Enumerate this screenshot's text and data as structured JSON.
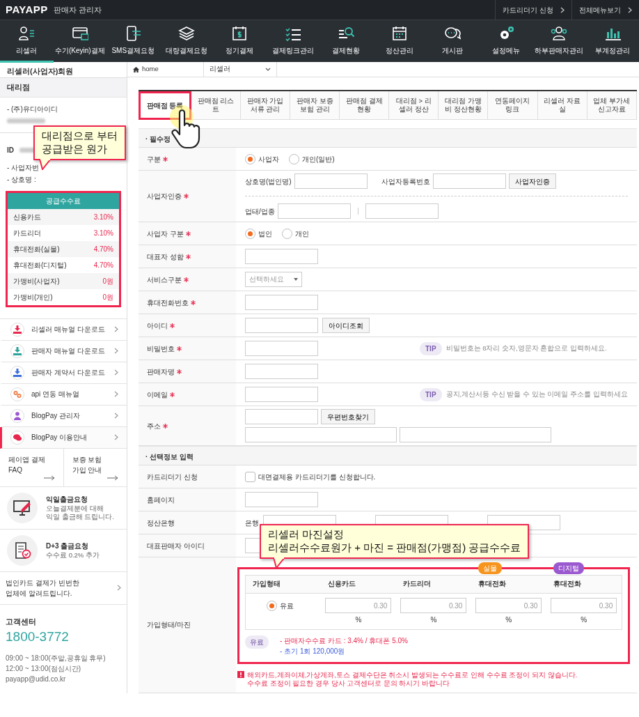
{
  "header": {
    "logo": "PAYAPP",
    "subtitle": "판매자 관리자",
    "links": [
      {
        "label": "카드리더기 신청"
      },
      {
        "label": "전체메뉴보기"
      }
    ]
  },
  "nav": [
    {
      "label": "리셀러",
      "selected": true
    },
    {
      "label": "수기(Keyin)결제",
      "selected": false
    },
    {
      "label": "SMS결제요청",
      "selected": false
    },
    {
      "label": "대량결제요청",
      "selected": false
    },
    {
      "label": "정기결제",
      "selected": false
    },
    {
      "label": "결제링크관리",
      "selected": false
    },
    {
      "label": "결제현황",
      "selected": false
    },
    {
      "label": "정산관리",
      "selected": false
    },
    {
      "label": "게시판",
      "selected": false
    },
    {
      "label": "설정메뉴",
      "selected": false
    },
    {
      "label": "하부판매자관리",
      "selected": false
    },
    {
      "label": "부계정관리",
      "selected": false
    }
  ],
  "sidebar": {
    "member_type": "리셀러(사업자)회원",
    "agency": {
      "title": "대리점",
      "lines": [
        "- (주)유디아이디"
      ]
    },
    "account": {
      "id_label": "ID",
      "lines": [
        "- 사업자번",
        "- 상호명 :"
      ]
    },
    "fee_table": {
      "title": "공급수수료",
      "rows": [
        {
          "name": "신용카드",
          "value": "3.10%"
        },
        {
          "name": "카드리더",
          "value": "3.10%"
        },
        {
          "name": "휴대전화(실물)",
          "value": "4.70%"
        },
        {
          "name": "휴대전화(디지털)",
          "value": "4.70%"
        },
        {
          "name": "가맹비(사업자)",
          "value": "0원"
        },
        {
          "name": "가맹비(개인)",
          "value": "0원"
        }
      ]
    },
    "menu": [
      {
        "label": "리셀러 매뉴얼 다운로드",
        "kind": "download",
        "color": "#e8264c",
        "selected": false
      },
      {
        "label": "판매자 매뉴얼 다운로드",
        "kind": "download",
        "color": "#2aa39a",
        "selected": false
      },
      {
        "label": "판매자 계약서 다운로드",
        "kind": "download",
        "color": "#3b6fd8",
        "selected": false
      },
      {
        "label": "api 연동 매뉴얼",
        "kind": "link",
        "color": "#f07b3f",
        "selected": false
      },
      {
        "label": "BlogPay 관리자",
        "kind": "person",
        "color": "#9b59d0",
        "selected": false
      },
      {
        "label": "BlogPay 이용안내",
        "kind": "chat",
        "color": "#e8264c",
        "selected": true
      }
    ],
    "quick_links": [
      {
        "text": "페이앱 결제\nFAQ"
      },
      {
        "text": "보증 보험\n가입 안내"
      }
    ],
    "promos": [
      {
        "kind": "monitor",
        "title": "익일출금요청",
        "desc": "오늘결제분에 대해\n익일 출금해 드립니다."
      },
      {
        "kind": "document",
        "title": "D+3 출금요청",
        "desc": "수수료 0.2% 추가"
      }
    ],
    "notice": "법인카드 결제가 빈번한\n업체에 알려드립니다.",
    "support": {
      "title": "고객센터",
      "phone": "1800-3772",
      "lines": [
        "09:00 ~ 18:00(주말,공휴일 휴무)",
        "12:00 ~ 13:00(점심시간)",
        "payapp@udid.co.kr"
      ]
    }
  },
  "breadcrumb": {
    "home": "home",
    "current": "리셀러"
  },
  "tabs": [
    {
      "label": "판매점 등록",
      "selected": true
    },
    {
      "label": "판매점 리스트",
      "selected": false
    },
    {
      "label": "판매자 가입서류 관리",
      "selected": false
    },
    {
      "label": "판매자 보증보험 관리",
      "selected": false
    },
    {
      "label": "판매점 결제현황",
      "selected": false
    },
    {
      "label": "대리점 > 리셀러 정산",
      "selected": false
    },
    {
      "label": "대리점 가맹비 정산현황",
      "selected": false
    },
    {
      "label": "연동페이지 링크",
      "selected": false
    },
    {
      "label": "리셀러 자료실",
      "selected": false
    },
    {
      "label": "업체 부가세 신고자료",
      "selected": false
    }
  ],
  "sections": [
    {
      "title": "· 필수정",
      "rows": [
        {
          "kind": "radio",
          "label": "구분",
          "required": true,
          "options": [
            {
              "label": "사업자",
              "selected": true
            },
            {
              "label": "개인(일반)",
              "selected": false
            }
          ]
        },
        {
          "kind": "business",
          "label": "사업자인증",
          "required": true,
          "name_label": "상호명(법인명)",
          "number_label": "사업자등록번호",
          "button": "사업자인증",
          "type_label": "업태/업종"
        },
        {
          "kind": "radio",
          "label": "사업자 구분",
          "required": true,
          "options": [
            {
              "label": "법인",
              "selected": true
            },
            {
              "label": "개인",
              "selected": false
            }
          ]
        },
        {
          "kind": "input",
          "label": "대표자 성함",
          "required": true
        },
        {
          "kind": "select",
          "label": "서비스구분",
          "required": true,
          "placeholder": "선택하세요"
        },
        {
          "kind": "input",
          "label": "휴대전화번호",
          "required": true
        },
        {
          "kind": "input",
          "label": "아이디",
          "required": true,
          "button": "아이디조회"
        },
        {
          "kind": "input",
          "label": "비밀번호",
          "required": true,
          "tip": "TIP",
          "tip_text": "비밀번호는 8자리 숫자,영문자 혼합으로 입력하세요."
        },
        {
          "kind": "input",
          "label": "판매자명",
          "required": true
        },
        {
          "kind": "input",
          "label": "이메일",
          "required": true,
          "tip": "TIP",
          "tip_text": "공지,계산서등 수신 받을 수 있는 이메일 주소를 입력하세요"
        },
        {
          "kind": "address",
          "label": "주소",
          "required": true,
          "button": "우편번호찾기"
        }
      ]
    },
    {
      "title": "· 선택정보 입력",
      "rows": [
        {
          "kind": "checkbox",
          "label": "카드리더기 신청",
          "required": false,
          "checked": false,
          "text": "대면결제용 카드리더기를 신청합니다."
        },
        {
          "kind": "input",
          "label": "홈페이지",
          "required": false
        },
        {
          "kind": "bank",
          "label": "정산은행",
          "required": false,
          "text": "은행"
        },
        {
          "kind": "input",
          "label": "대표판매자 아이디",
          "required": false
        },
        {
          "kind": "margin",
          "label": "가입형태/마진",
          "required": false,
          "columns": [
            {
              "label": "가입형태"
            },
            {
              "label": "신용카드"
            },
            {
              "label": "카드리더"
            },
            {
              "label": "휴대전화",
              "badge": "실물",
              "color": "#f7941d"
            },
            {
              "label": "휴대전화",
              "badge": "디지털",
              "color": "#9b59d0"
            }
          ],
          "plan": {
            "label": "유료",
            "selected": true
          },
          "inputs": [
            {
              "value": "0.30",
              "unit": "%"
            },
            {
              "value": "0.30",
              "unit": "%"
            },
            {
              "value": "0.30",
              "unit": "%"
            },
            {
              "value": "0.30",
              "unit": "%"
            }
          ],
          "badge": "유료",
          "notes": [
            {
              "text": "- 판매자수수료 카드 : 3.4% / 휴대폰 5.0%",
              "kind": "fee"
            },
            {
              "text": "- 초기 1회 120,000원",
              "kind": "setup"
            }
          ],
          "warning": "해외카드,계좌이체,가상계좌,토스 결제수단은 취소시 발생되는 수수료로 인해 수수료 조정이 되지 않습니다.\n수수료 조정이 필요한 경우 당사 고객센터로 문의 하시기 바랍니다"
        }
      ]
    }
  ],
  "callouts": [
    {
      "lines": [
        "대리점으로 부터",
        "공급받은 원가"
      ]
    },
    {
      "lines": [
        "리셀러 마진설정",
        "리셀러수수료원가 + 마진 = 판매점(가맹점) 공급수수료"
      ]
    }
  ]
}
